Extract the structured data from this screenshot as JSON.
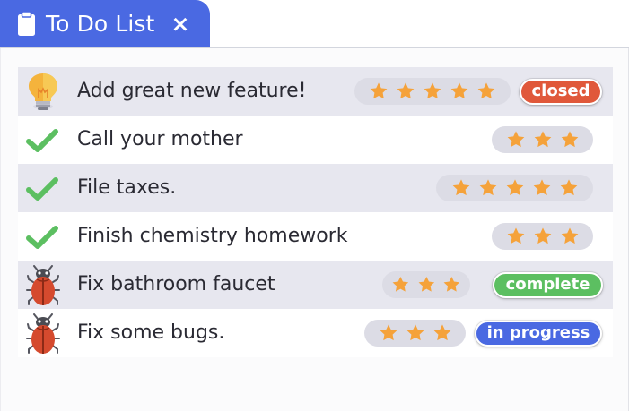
{
  "tab": {
    "title": "To Do List",
    "close": "×",
    "icon": "clipboard-icon",
    "color": "#4a69e2"
  },
  "todos": [
    {
      "icon": "lightbulb-icon",
      "label": "Add great new feature!",
      "stars": 5,
      "status": "closed",
      "status_color": "#e0583a"
    },
    {
      "icon": "checkmark-icon",
      "label": "Call your mother",
      "stars": 3
    },
    {
      "icon": "checkmark-icon",
      "label": "File taxes.",
      "stars": 5
    },
    {
      "icon": "checkmark-icon",
      "label": "Finish chemistry homework",
      "stars": 3
    },
    {
      "icon": "bug-icon",
      "label": "Fix bathroom faucet",
      "stars": 3,
      "status": "complete",
      "status_color": "#5cbf61"
    },
    {
      "icon": "bug-icon",
      "label": "Fix some bugs.",
      "stars": 3,
      "status": "in progress",
      "status_color": "#4a69e2"
    }
  ],
  "colors": {
    "star": "#f5a23a",
    "check": "#5cbf61",
    "shaded_row": "#e7e7ef"
  }
}
